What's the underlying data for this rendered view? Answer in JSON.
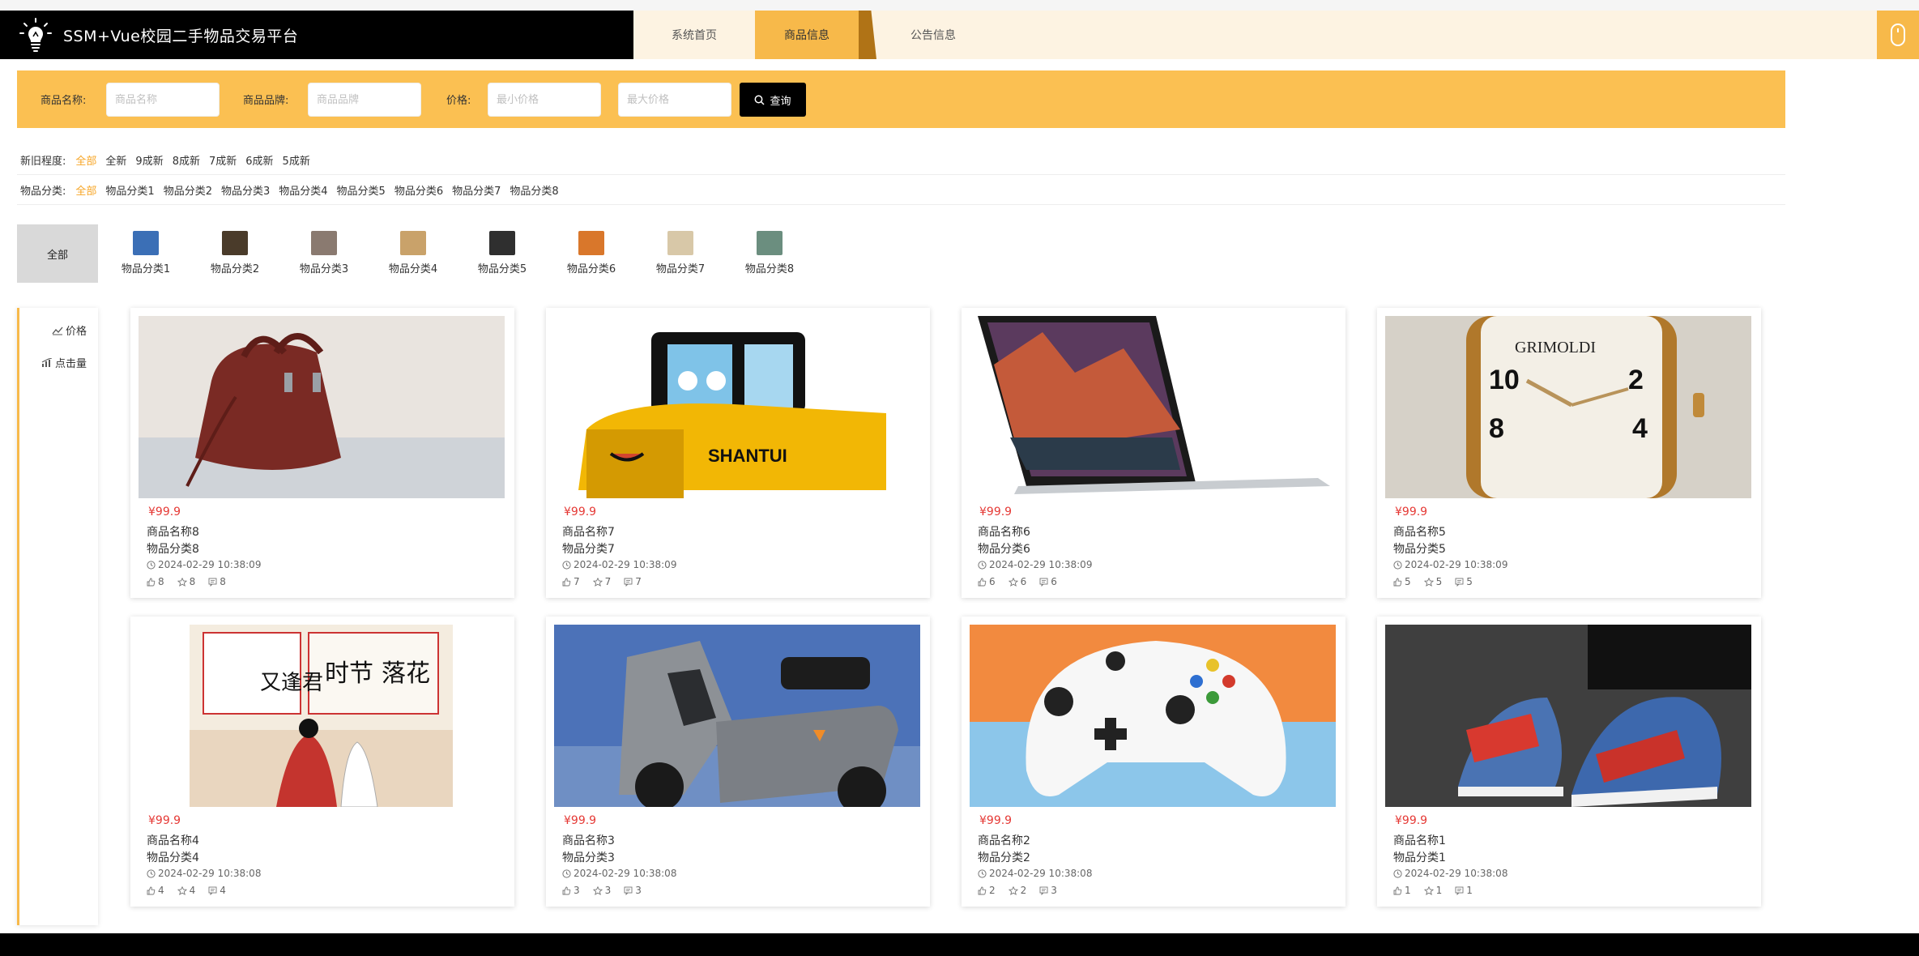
{
  "header": {
    "title": "SSM+Vue校园二手物品交易平台",
    "nav": [
      {
        "label": "系统首页"
      },
      {
        "label": "商品信息"
      },
      {
        "label": "公告信息"
      }
    ]
  },
  "search": {
    "name_label": "商品名称:",
    "name_placeholder": "商品名称",
    "brand_label": "商品品牌:",
    "brand_placeholder": "商品品牌",
    "price_label": "价格:",
    "min_placeholder": "最小价格",
    "max_placeholder": "最大价格",
    "button_label": "查询"
  },
  "filters": {
    "condition_label": "新旧程度:",
    "condition_options": [
      "全部",
      "全新",
      "9成新",
      "8成新",
      "7成新",
      "6成新",
      "5成新"
    ],
    "category_label": "物品分类:",
    "category_options": [
      "全部",
      "物品分类1",
      "物品分类2",
      "物品分类3",
      "物品分类4",
      "物品分类5",
      "物品分类6",
      "物品分类7",
      "物品分类8"
    ]
  },
  "category_tiles": {
    "all_label": "全部",
    "items": [
      {
        "label": "物品分类1",
        "color": "#3b6fb6"
      },
      {
        "label": "物品分类2",
        "color": "#4a3b2a"
      },
      {
        "label": "物品分类3",
        "color": "#8a7a70"
      },
      {
        "label": "物品分类4",
        "color": "#c9a26a"
      },
      {
        "label": "物品分类5",
        "color": "#2f2f2f"
      },
      {
        "label": "物品分类6",
        "color": "#d9772b"
      },
      {
        "label": "物品分类7",
        "color": "#d8c8a8"
      },
      {
        "label": "物品分类8",
        "color": "#6b8e7f"
      }
    ]
  },
  "sort": {
    "price_label": "价格",
    "clicks_label": "点击量"
  },
  "products": [
    {
      "price": "¥99.9",
      "name": "商品名称8",
      "category": "物品分类8",
      "time": "2024-02-29 10:38:09",
      "likes": "8",
      "favorites": "8",
      "comments": "8",
      "image": "handbag"
    },
    {
      "price": "¥99.9",
      "name": "商品名称7",
      "category": "物品分类7",
      "time": "2024-02-29 10:38:09",
      "likes": "7",
      "favorites": "7",
      "comments": "7",
      "image": "loader-cartoon"
    },
    {
      "price": "¥99.9",
      "name": "商品名称6",
      "category": "物品分类6",
      "time": "2024-02-29 10:38:09",
      "likes": "6",
      "favorites": "6",
      "comments": "6",
      "image": "laptop"
    },
    {
      "price": "¥99.9",
      "name": "商品名称5",
      "category": "物品分类5",
      "time": "2024-02-29 10:38:09",
      "likes": "5",
      "favorites": "5",
      "comments": "5",
      "image": "watch"
    },
    {
      "price": "¥99.9",
      "name": "商品名称4",
      "category": "物品分类4",
      "time": "2024-02-29 10:38:08",
      "likes": "4",
      "favorites": "4",
      "comments": "4",
      "image": "book-cover"
    },
    {
      "price": "¥99.9",
      "name": "商品名称3",
      "category": "物品分类3",
      "time": "2024-02-29 10:38:08",
      "likes": "3",
      "favorites": "3",
      "comments": "3",
      "image": "scooter"
    },
    {
      "price": "¥99.9",
      "name": "商品名称2",
      "category": "物品分类2",
      "time": "2024-02-29 10:38:08",
      "likes": "2",
      "favorites": "2",
      "comments": "3",
      "image": "game-controller"
    },
    {
      "price": "¥99.9",
      "name": "商品名称1",
      "category": "物品分类1",
      "time": "2024-02-29 10:38:08",
      "likes": "1",
      "favorites": "1",
      "comments": "1",
      "image": "sneakers"
    }
  ],
  "colors": {
    "accent": "#f7b94a",
    "search_bar": "#fbc052",
    "active_filter": "#f7a525",
    "price": "#e53935"
  }
}
